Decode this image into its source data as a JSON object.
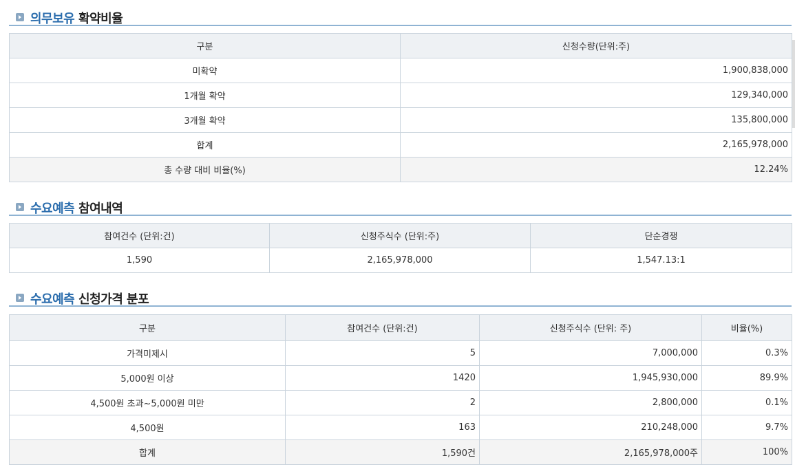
{
  "sections": {
    "lockup": {
      "title_accent": "의무보유",
      "title_rest": "확약비율",
      "headers": [
        "구분",
        "신청수량(단위:주)"
      ],
      "rows": [
        [
          "미확약",
          "1,900,838,000"
        ],
        [
          "1개월 확약",
          "129,340,000"
        ],
        [
          "3개월 확약",
          "135,800,000"
        ],
        [
          "합계",
          "2,165,978,000"
        ],
        [
          "총 수량 대비 비율(%)",
          "12.24%"
        ]
      ]
    },
    "participation": {
      "title_accent": "수요예측",
      "title_rest": "참여내역",
      "headers": [
        "참여건수 (단위:건)",
        "신청주식수 (단위:주)",
        "단순경쟁"
      ],
      "rows": [
        [
          "1,590",
          "2,165,978,000",
          "1,547.13:1"
        ]
      ]
    },
    "distribution": {
      "title_accent": "수요예측",
      "title_rest": "신청가격 분포",
      "headers": [
        "구분",
        "참여건수 (단위:건)",
        "신청주식수 (단위: 주)",
        "비율(%)"
      ],
      "rows": [
        [
          "가격미제시",
          "5",
          "7,000,000",
          "0.3%"
        ],
        [
          "5,000원 이상",
          "1420",
          "1,945,930,000",
          "89.9%"
        ],
        [
          "4,500원 초과~5,000원 미만",
          "2",
          "2,800,000",
          "0.1%"
        ],
        [
          "4,500원",
          "163",
          "210,248,000",
          "9.7%"
        ],
        [
          "합계",
          "1,590건",
          "2,165,978,000주",
          "100%"
        ]
      ]
    }
  }
}
